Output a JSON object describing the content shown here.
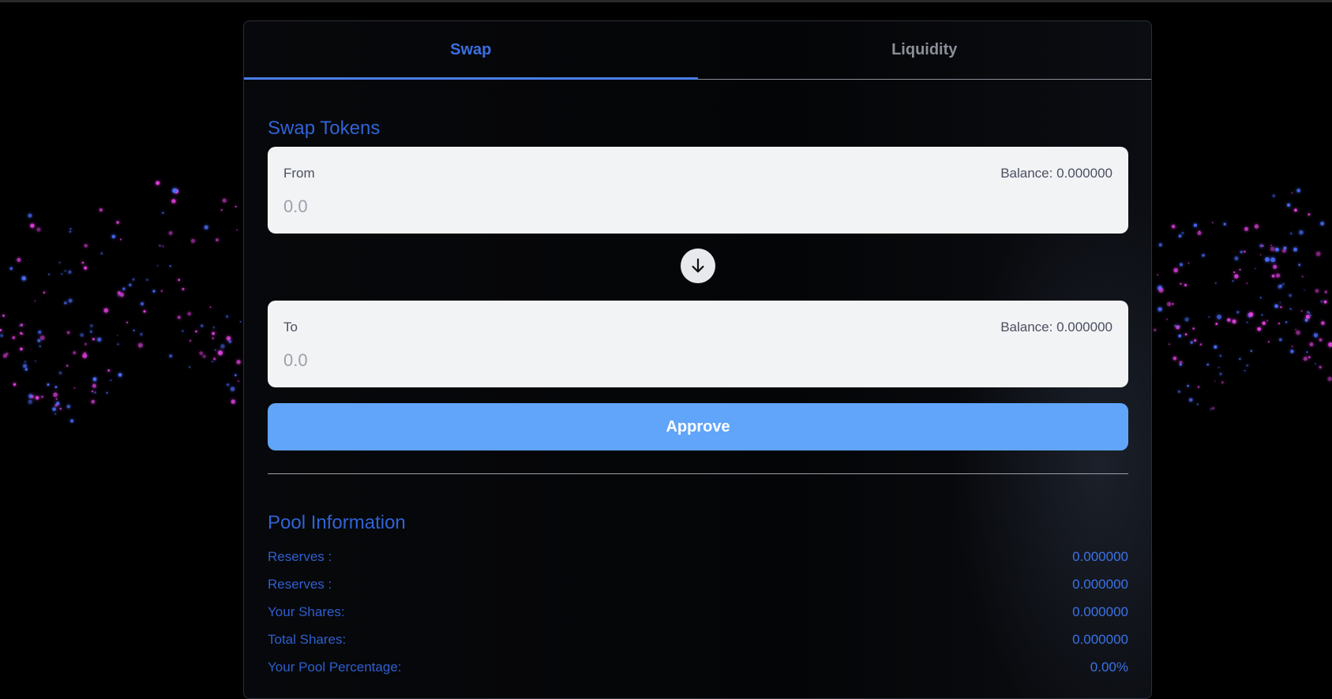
{
  "tabs": [
    {
      "label": "Swap",
      "active": true
    },
    {
      "label": "Liquidity",
      "active": false
    }
  ],
  "swap": {
    "title": "Swap Tokens",
    "from": {
      "label": "From",
      "balance": "Balance: 0.000000",
      "placeholder": "0.0"
    },
    "to": {
      "label": "To",
      "balance": "Balance: 0.000000",
      "placeholder": "0.0"
    },
    "arrow_icon": "arrow-down-icon",
    "approve_label": "Approve"
  },
  "pool": {
    "title": "Pool Information",
    "rows": [
      {
        "label": "Reserves :",
        "value": "0.000000"
      },
      {
        "label": "Reserves :",
        "value": "0.000000"
      },
      {
        "label": "Your Shares:",
        "value": "0.000000"
      },
      {
        "label": "Total Shares:",
        "value": "0.000000"
      },
      {
        "label": "Your Pool Percentage:",
        "value": "0.00%"
      }
    ]
  },
  "colors": {
    "accent": "#3b6fe0",
    "button": "#60a5fa",
    "particle_pink": "#e040e0",
    "particle_blue": "#4a6cff"
  }
}
